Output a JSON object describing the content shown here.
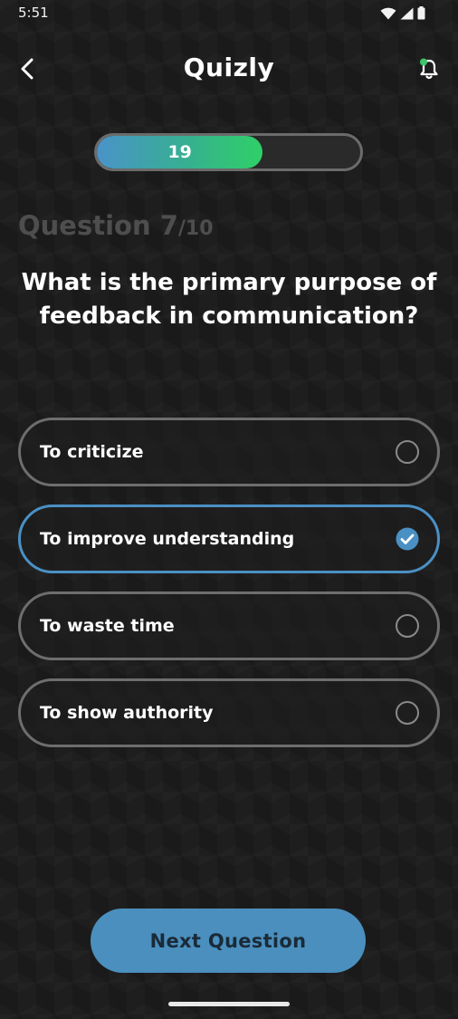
{
  "status_bar": {
    "time": "5:51",
    "icons": [
      "wifi-icon",
      "cellular-signal-icon",
      "battery-icon"
    ]
  },
  "app_bar": {
    "title": "Quizly",
    "back_icon": "chevron-left-icon",
    "notification_icon": "bell-icon",
    "notification_dot_color": "#3ec46d"
  },
  "progress": {
    "value": "19",
    "fill_fraction": 0.63
  },
  "question": {
    "label": "Question 7",
    "total": "/10",
    "text": "What is the primary purpose of feedback in communication?"
  },
  "options": [
    {
      "label": "To criticize",
      "selected": false
    },
    {
      "label": "To improve understanding",
      "selected": true
    },
    {
      "label": "To waste time",
      "selected": false
    },
    {
      "label": "To show authority",
      "selected": false
    }
  ],
  "next_button": {
    "label": "Next Question"
  },
  "colors": {
    "accent": "#4a90c4",
    "background": "#1e1e1e",
    "progress_start": "#4a93c9",
    "progress_end": "#2fd068"
  }
}
